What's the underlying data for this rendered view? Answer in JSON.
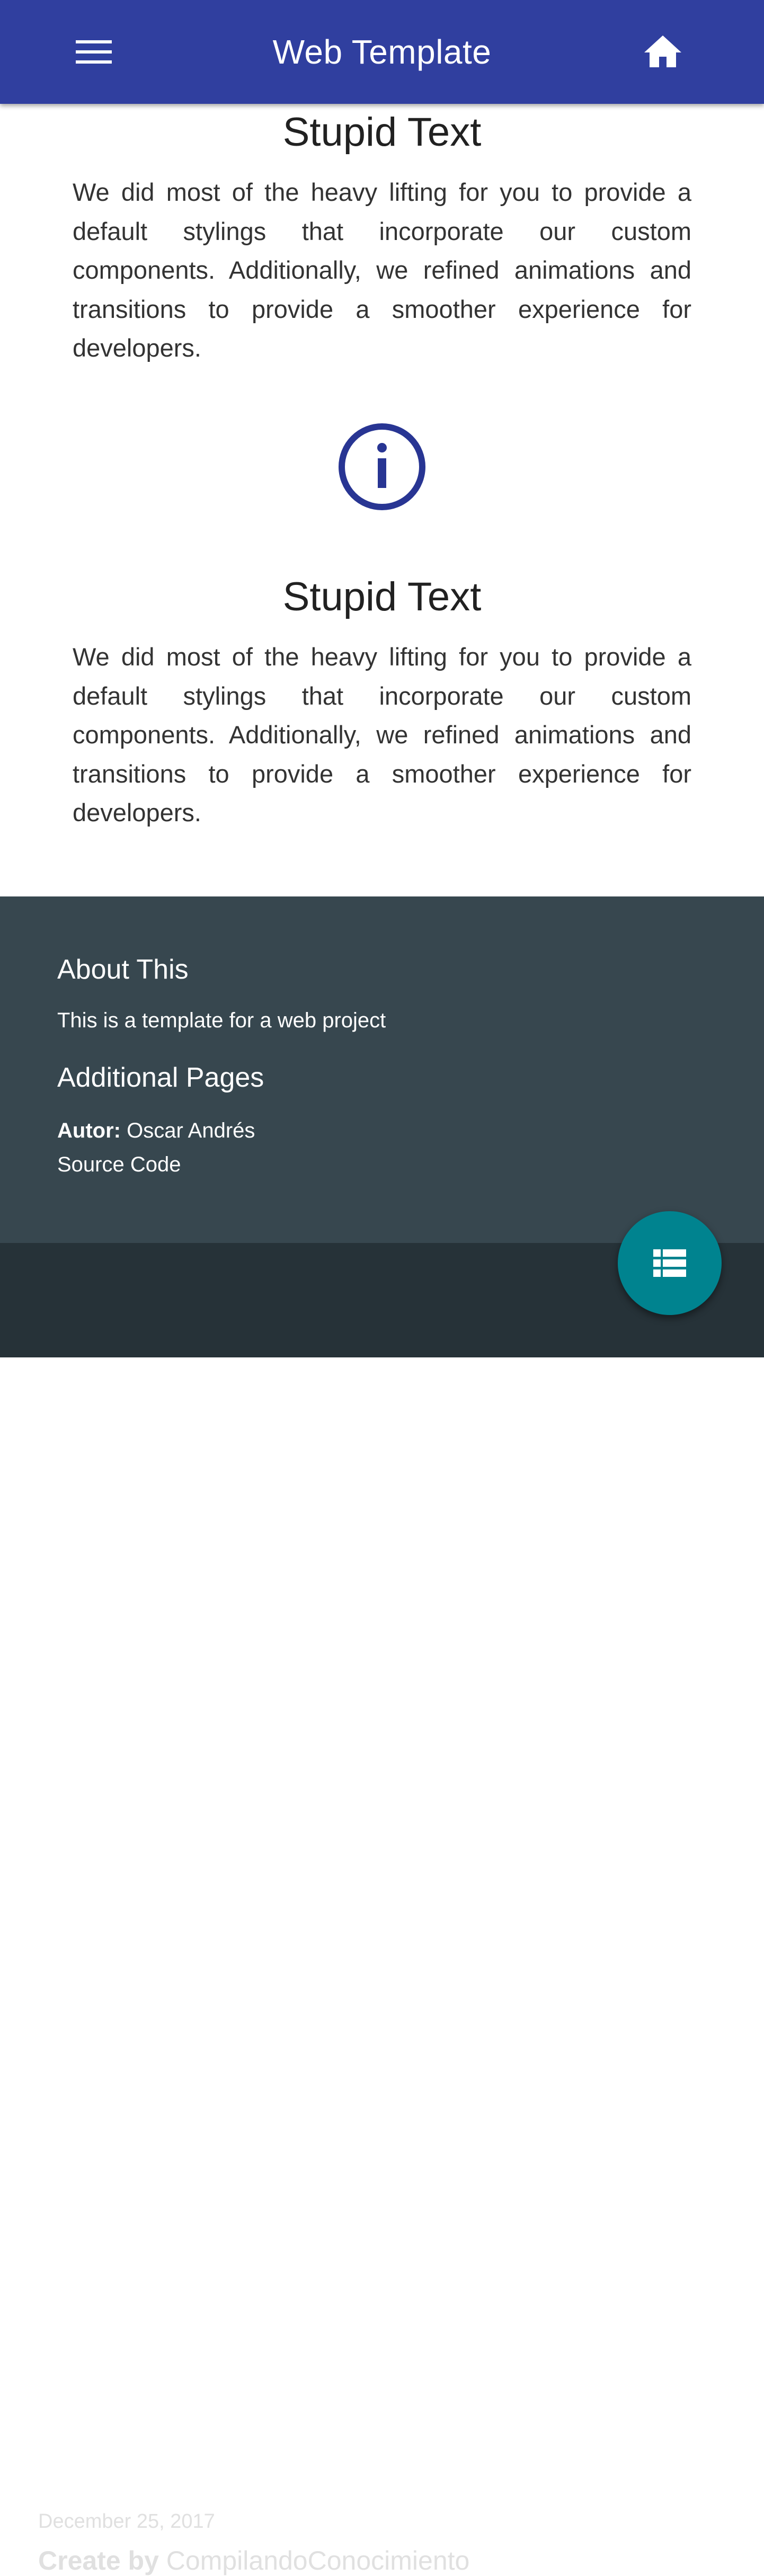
{
  "appbar": {
    "title": "Web Template",
    "menu_icon": "menu-icon",
    "home_icon": "home-icon",
    "color": "#303f9f"
  },
  "sections": [
    {
      "title": "Stupid Text",
      "text": "We did most of the heavy lifting for you to provide a default stylings that incorporate our custom components. Additionally, we refined animations and transitions to provide a smoother experience for developers."
    },
    {
      "icon": "info-icon",
      "title": "Stupid Text",
      "text": "We did most of the heavy lifting for you to provide a default stylings that incorporate our custom components. Additionally, we refined animations and transitions to provide a smoother experience for developers."
    }
  ],
  "footer": {
    "about_title": "About This",
    "about_text": "This is a template for a web project",
    "pages_title": "Additional Pages",
    "author_label": "Autor:",
    "author_name": "Oscar Andrés",
    "source_code_link": "Source Code",
    "color": "#37474f"
  },
  "bottom_bar": {
    "date": "December 25, 2017",
    "credit_label": "Create by",
    "credit_name": "CompilandoConocimiento",
    "color": "#263238"
  },
  "fab": {
    "icon": "list-icon",
    "color": "#00838f"
  }
}
